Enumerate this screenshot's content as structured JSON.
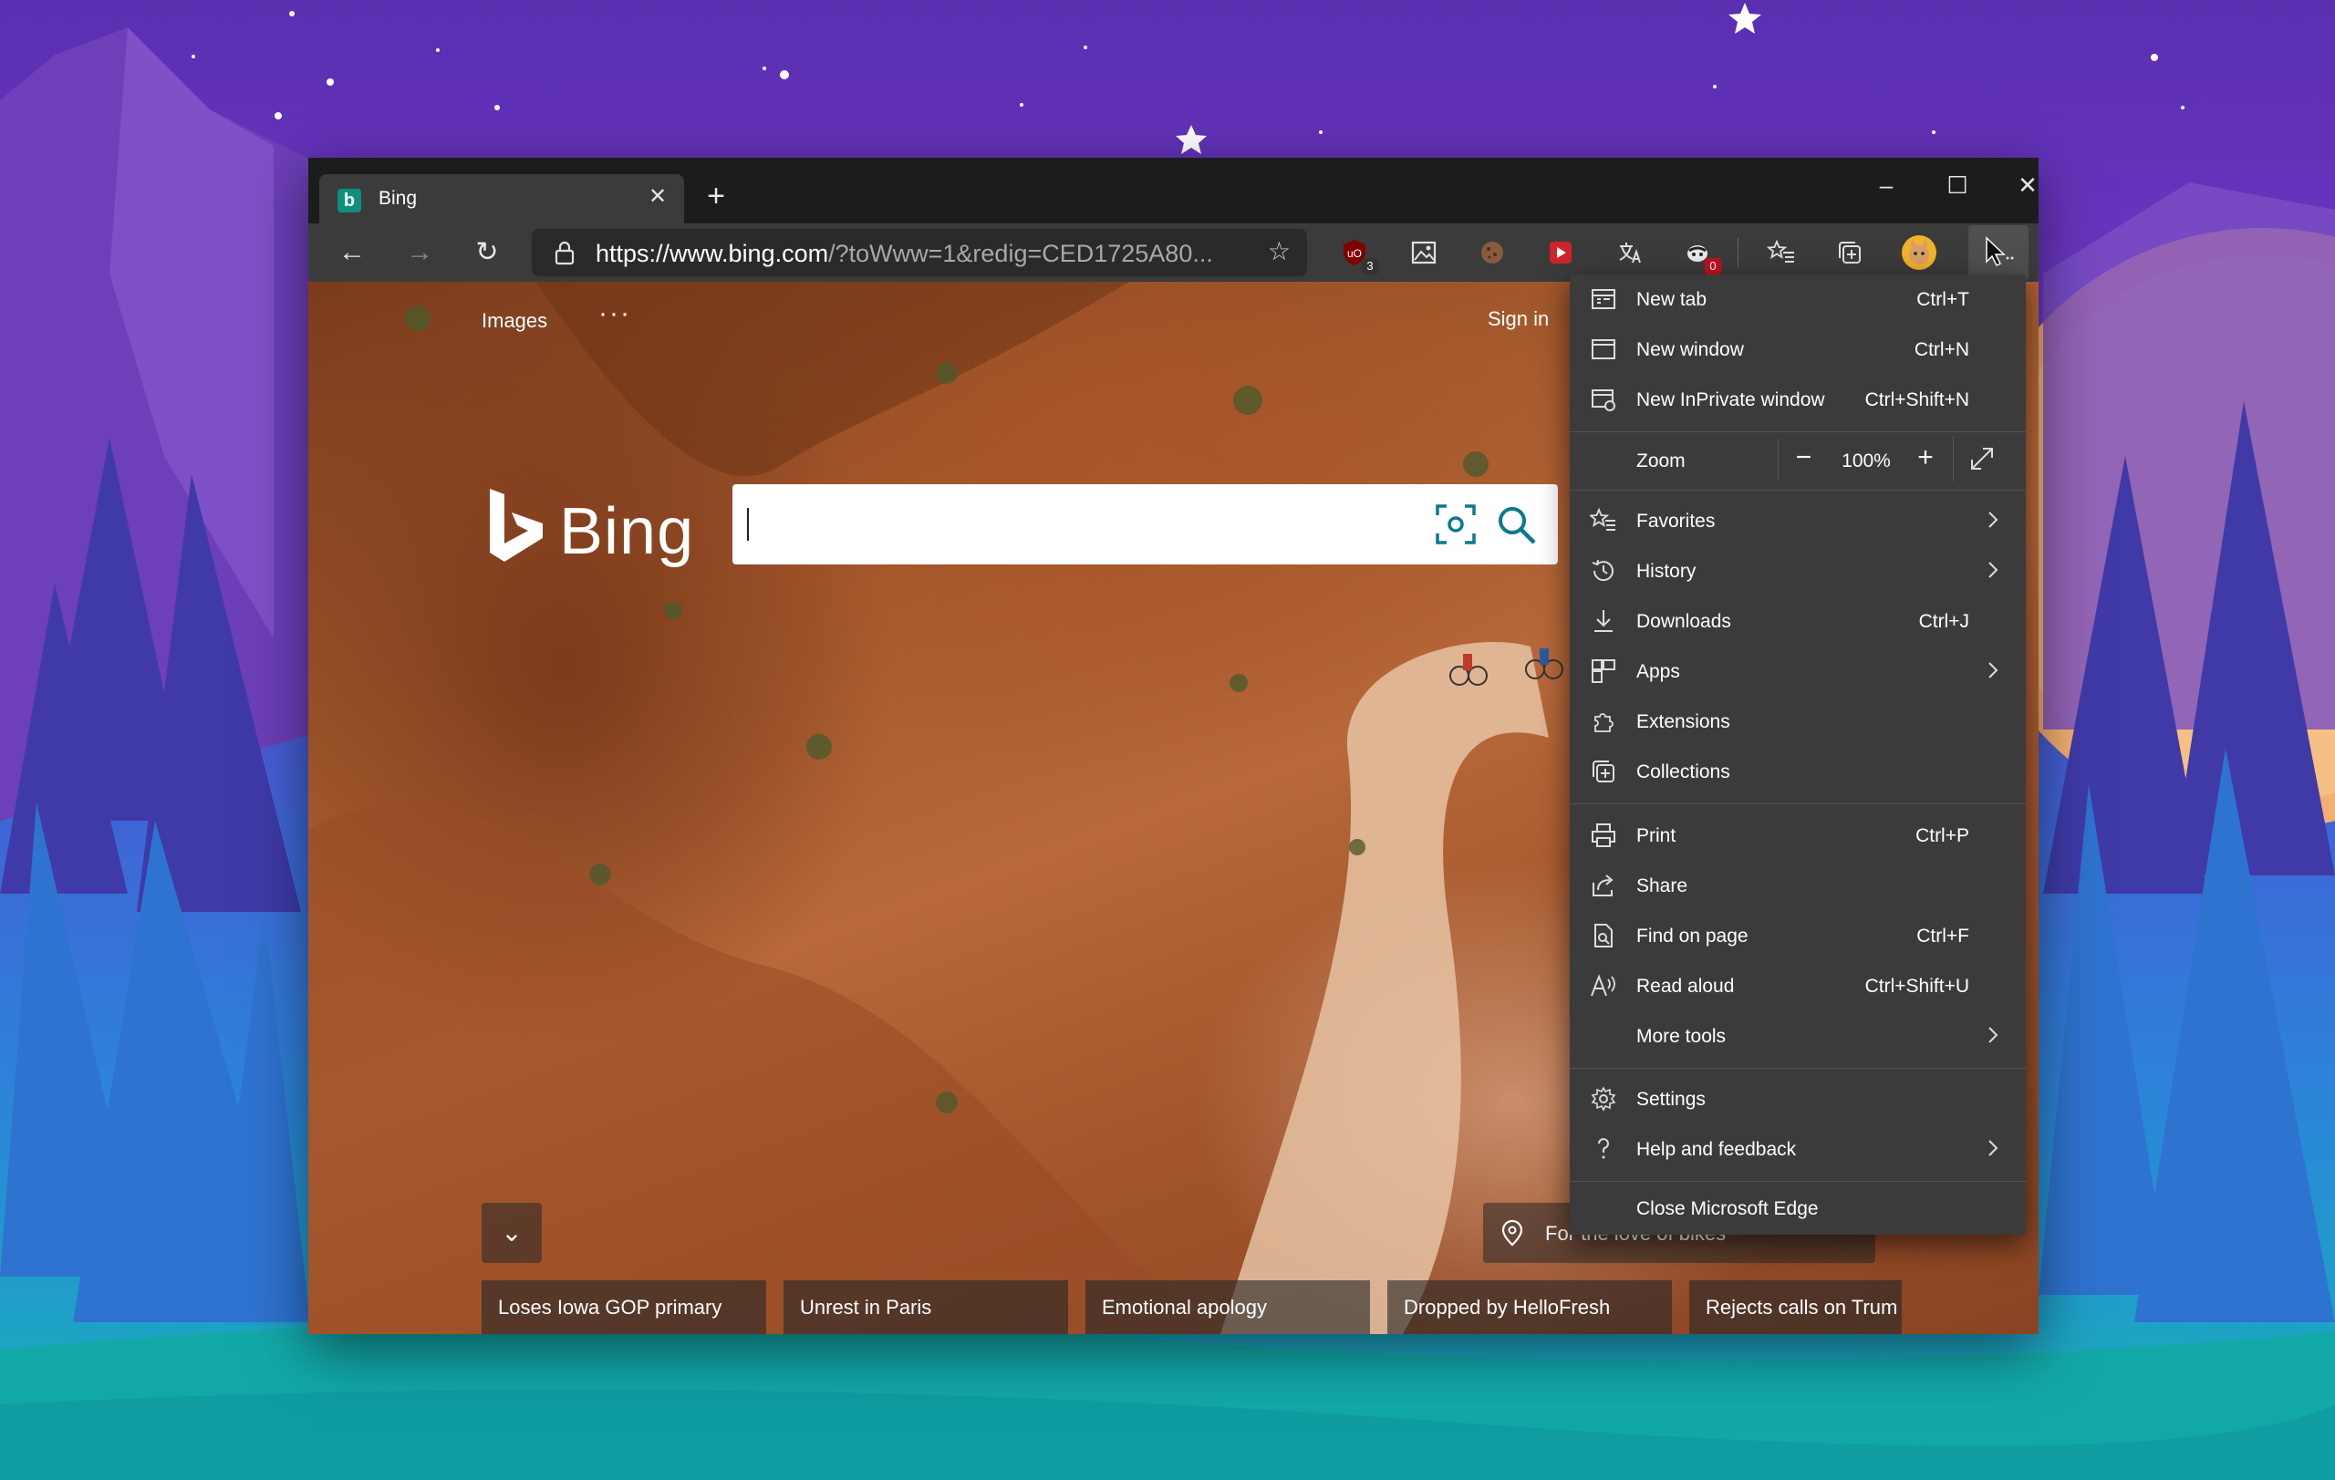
{
  "tab": {
    "title": "Bing"
  },
  "address": {
    "url_host": "https://www.bing.com",
    "url_path": "/?toWww=1&redig=CED1725A80..."
  },
  "extensions": [
    {
      "name": "ublock-origin-icon",
      "badge": "3",
      "badge_color": "#c50f1f"
    },
    {
      "name": "image-tool-icon",
      "badge": ""
    },
    {
      "name": "cookie-icon",
      "badge": ""
    },
    {
      "name": "red-play-icon",
      "badge": ""
    },
    {
      "name": "translate-icon",
      "badge": ""
    },
    {
      "name": "privacy-badger-icon",
      "badge": "0",
      "badge_color": "#c50f1f"
    }
  ],
  "page": {
    "nav_images": "Images",
    "nav_more": "···",
    "signin": "Sign in",
    "logo_text": "Bing",
    "location_text": "For the love of bikes",
    "news": [
      "Loses Iowa GOP primary",
      "Unrest in Paris",
      "Emotional apology",
      "Dropped by HelloFresh",
      "Rejects calls on Trum"
    ]
  },
  "menu": {
    "new_tab": {
      "label": "New tab",
      "shortcut": "Ctrl+T"
    },
    "new_window": {
      "label": "New window",
      "shortcut": "Ctrl+N"
    },
    "new_inprivate": {
      "label": "New InPrivate window",
      "shortcut": "Ctrl+Shift+N"
    },
    "zoom": {
      "label": "Zoom",
      "value": "100%",
      "minus": "−",
      "plus": "+"
    },
    "favorites": {
      "label": "Favorites"
    },
    "history": {
      "label": "History"
    },
    "downloads": {
      "label": "Downloads",
      "shortcut": "Ctrl+J"
    },
    "apps": {
      "label": "Apps"
    },
    "extensions": {
      "label": "Extensions"
    },
    "collections": {
      "label": "Collections"
    },
    "print": {
      "label": "Print",
      "shortcut": "Ctrl+P"
    },
    "share": {
      "label": "Share"
    },
    "find": {
      "label": "Find on page",
      "shortcut": "Ctrl+F"
    },
    "read_aloud": {
      "label": "Read aloud",
      "shortcut": "Ctrl+Shift+U"
    },
    "more_tools": {
      "label": "More tools"
    },
    "settings": {
      "label": "Settings"
    },
    "help": {
      "label": "Help and feedback"
    },
    "close": {
      "label": "Close Microsoft Edge"
    }
  },
  "colors": {
    "accent": "#108f7e",
    "menu_bg": "#3b3b3b",
    "toolbar_bg": "#3b3b3b",
    "titlebar_bg": "#1c1c1c"
  }
}
